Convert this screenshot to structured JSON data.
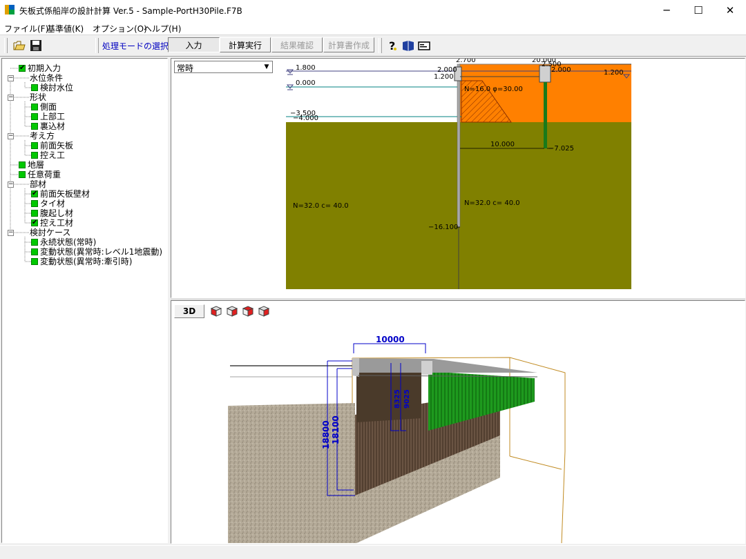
{
  "window": {
    "title": "矢板式係船岸の設計計算 Ver.5 - Sample-PortH30Pile.F7B",
    "minimize": "─",
    "maximize": "☐",
    "close": "✕"
  },
  "menu": {
    "file": "ファイル(F)",
    "standard": "基準値(K)",
    "options": "オプション(O)",
    "help": "ヘルプ(H)"
  },
  "toolbar": {
    "mode_label": "処理モードの選択",
    "input": "入力",
    "calc": "計算実行",
    "result": "結果確認",
    "report": "計算書作成",
    "icons": [
      "open-folder-icon",
      "save-icon",
      "help-icon",
      "book-icon",
      "card-icon"
    ]
  },
  "tree": {
    "initial_input": "初期入力",
    "water_level": "水位条件",
    "design_water_level": "検討水位",
    "shape": "形状",
    "side_view": "側面",
    "superstructure": "上部工",
    "backfill": "裏込材",
    "approach": "考え方",
    "front_sheet_pile": "前面矢板",
    "anchor_work": "控え工",
    "strata": "地層",
    "arbitrary_load": "任意荷重",
    "members": "部材",
    "front_sheet_pile_wall": "前面矢板壁材",
    "tie_rod": "タイ材",
    "wale": "腹起し材",
    "anchor_material": "控え工材",
    "cases": "検討ケース",
    "permanent": "永続状態(常時)",
    "variable_l1": "変動状態(異常時:レベル1地震動)",
    "variable_tow": "変動状態(異常時:牽引時)"
  },
  "section_view": {
    "case_select": "常時",
    "dims": {
      "top_width": "2.700",
      "anchor_distance_top": "20.000",
      "level_1800": "1.800",
      "level_0000": "0.000",
      "level_m3500": "−3.500",
      "level_m4000": "−4.000",
      "cap_2000_left": "2.000",
      "cap_1200_left": "1.200",
      "anchor_cap_2500": "2.500",
      "anchor_cap_2000": "2.000",
      "right_1200": "1.200",
      "backfill_params": "N=16.0  φ=30.00",
      "anchor_span": "10.000",
      "anchor_tip": "−7.025",
      "soil_left": "N=32.0 c=  40.0",
      "soil_right": "N=32.0 c=  40.0",
      "pile_tip": "−16.100"
    }
  },
  "view3d": {
    "button": "3D",
    "dim_10000": "10000",
    "dim_18800": "18800",
    "dim_18100": "18100",
    "dim_anchor_a": "8325",
    "dim_anchor_b": "9025",
    "colors": {
      "front_pile": "#5a4a3a",
      "anchor_pile": "#1f8f1f",
      "dimension": "#0000c8",
      "ground": "#b8b0a0"
    }
  },
  "colors": {
    "backfill": "#ff8000",
    "soil": "#808000",
    "node_green": "#00c800",
    "mode_label": "#0000c0"
  }
}
